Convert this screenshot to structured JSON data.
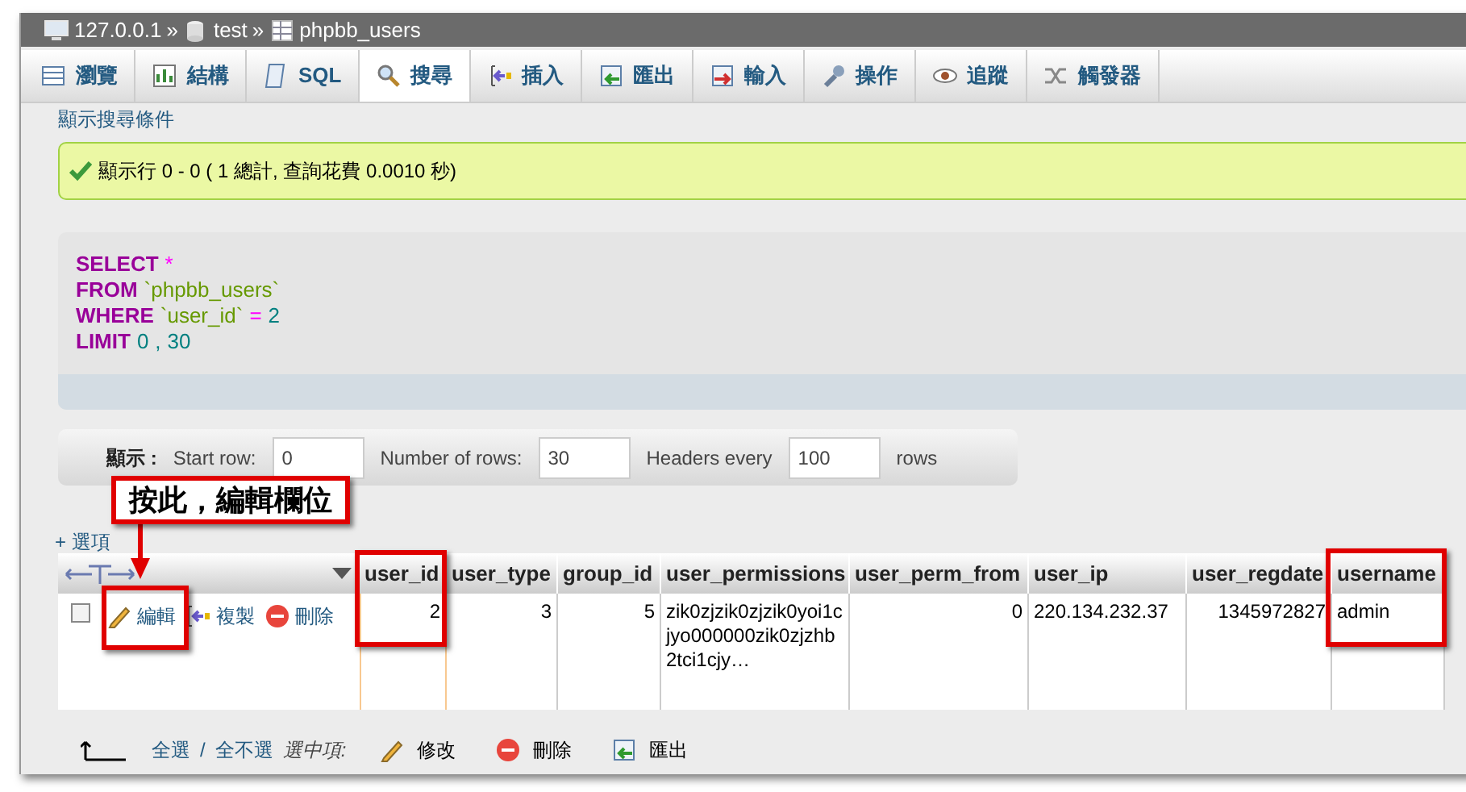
{
  "breadcrumb": [
    {
      "label": "127.0.0.1",
      "kind": "server"
    },
    {
      "label": "test",
      "kind": "database"
    },
    {
      "label": "phpbb_users",
      "kind": "table"
    }
  ],
  "breadcrumb_separator": "»",
  "tabs": [
    {
      "label": "瀏覽",
      "kind": "browse",
      "selected": false
    },
    {
      "label": "結構",
      "kind": "structure",
      "selected": false
    },
    {
      "label": "SQL",
      "kind": "sql",
      "selected": false
    },
    {
      "label": "搜尋",
      "kind": "search",
      "selected": true
    },
    {
      "label": "插入",
      "kind": "insert",
      "selected": false
    },
    {
      "label": "匯出",
      "kind": "export",
      "selected": false
    },
    {
      "label": "輸入",
      "kind": "import",
      "selected": false
    },
    {
      "label": "操作",
      "kind": "operations",
      "selected": false
    },
    {
      "label": "追蹤",
      "kind": "tracking",
      "selected": false
    },
    {
      "label": "觸發器",
      "kind": "triggers",
      "selected": false
    }
  ],
  "section_title": "顯示搜尋條件",
  "message": "顯示行 0 - 0 ( 1 總計, 查詢花費 0.0010 秒)",
  "sql": [
    [
      {
        "text": "SELECT",
        "kind": "keyword"
      },
      {
        "text": "*",
        "kind": "operator"
      }
    ],
    [
      {
        "text": "FROM",
        "kind": "keyword"
      },
      {
        "text": "`phpbb_users`",
        "kind": "identifier"
      }
    ],
    [
      {
        "text": "WHERE",
        "kind": "keyword"
      },
      {
        "text": "`user_id`",
        "kind": "identifier"
      },
      {
        "text": "=",
        "kind": "operator"
      },
      {
        "text": "2",
        "kind": "number"
      }
    ],
    [
      {
        "text": "LIMIT",
        "kind": "keyword"
      },
      {
        "text": "0",
        "kind": "number"
      },
      {
        "text": ",",
        "kind": "punct"
      },
      {
        "text": "30",
        "kind": "number"
      }
    ]
  ],
  "navigation": {
    "label": "顯示 :",
    "fields": [
      {
        "label": "Start row:",
        "value": "0"
      },
      {
        "label": "Number of rows:",
        "value": "30"
      },
      {
        "label": "Headers every",
        "value": "100"
      }
    ],
    "suffix": "rows"
  },
  "options_link": "+ 選項",
  "table": {
    "columns": [
      "user_id",
      "user_type",
      "group_id",
      "user_permissions",
      "user_perm_from",
      "user_ip",
      "user_regdate",
      "username"
    ],
    "rows": [
      {
        "checked": false,
        "actions": [
          {
            "label": "編輯",
            "kind": "edit"
          },
          {
            "label": "複製",
            "kind": "copy"
          },
          {
            "label": "刪除",
            "kind": "delete"
          }
        ],
        "cells": [
          "2",
          "3",
          "5",
          "zik0zjzik0zjzik0yoi1cjyo000000zik0zjzhb2tci1cjy…",
          "0",
          "220.134.232.37",
          "1345972827",
          "admin"
        ]
      }
    ]
  },
  "footer": {
    "select_all": "全選",
    "separator": "/",
    "deselect_all": "全不選",
    "with_selected": "選中項:",
    "actions": [
      {
        "label": "修改",
        "kind": "edit"
      },
      {
        "label": "刪除",
        "kind": "delete"
      },
      {
        "label": "匯出",
        "kind": "export"
      }
    ]
  },
  "callout": "按此，編輯欄位"
}
